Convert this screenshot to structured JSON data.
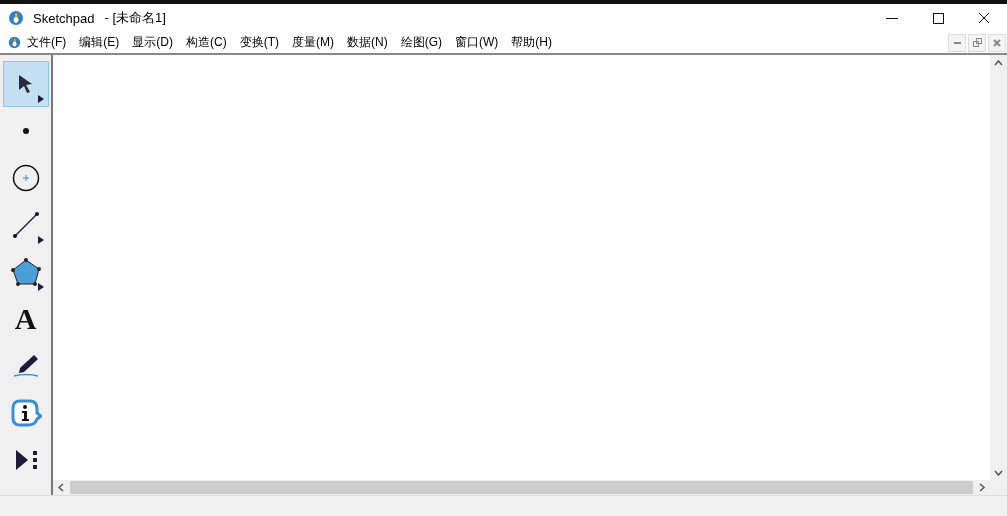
{
  "window": {
    "title": "Sketchpad",
    "document": "- [未命名1]"
  },
  "menu": [
    "文件(F)",
    "编辑(E)",
    "显示(D)",
    "构造(C)",
    "变换(T)",
    "度量(M)",
    "数据(N)",
    "绘图(G)",
    "窗口(W)",
    "帮助(H)"
  ],
  "tools": [
    {
      "kind": "arrow",
      "selected": true,
      "more": true
    },
    {
      "kind": "point",
      "selected": false,
      "more": false
    },
    {
      "kind": "compass",
      "selected": false,
      "more": false
    },
    {
      "kind": "line",
      "selected": false,
      "more": true
    },
    {
      "kind": "polygon",
      "selected": false,
      "more": true
    },
    {
      "kind": "text",
      "glyph": "A",
      "selected": false,
      "more": false
    },
    {
      "kind": "marker",
      "selected": false,
      "more": false
    },
    {
      "kind": "info",
      "selected": false,
      "more": false
    },
    {
      "kind": "custom",
      "selected": false,
      "more": false
    }
  ]
}
